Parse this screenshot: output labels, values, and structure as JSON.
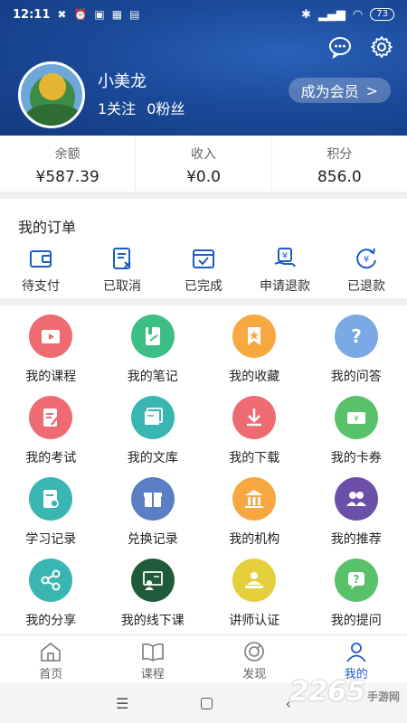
{
  "status_bar": {
    "time": "12:11",
    "battery": "73"
  },
  "profile": {
    "username": "小美龙",
    "following": "1关注",
    "followers": "0粉丝",
    "member_button": "成为会员",
    "member_chevron": ">"
  },
  "stats": [
    {
      "label": "余额",
      "value": "¥587.39"
    },
    {
      "label": "收入",
      "value": "¥0.0"
    },
    {
      "label": "积分",
      "value": "856.0"
    }
  ],
  "orders": {
    "title": "我的订单",
    "items": [
      {
        "label": "待支付",
        "icon": "wallet-icon"
      },
      {
        "label": "已取消",
        "icon": "cancel-doc-icon"
      },
      {
        "label": "已完成",
        "icon": "done-calendar-icon"
      },
      {
        "label": "申请退款",
        "icon": "refund-request-icon"
      },
      {
        "label": "已退款",
        "icon": "refunded-icon"
      }
    ]
  },
  "grid": [
    {
      "label": "我的课程",
      "icon": "course-icon",
      "color": "#ef6b72"
    },
    {
      "label": "我的笔记",
      "icon": "notes-icon",
      "color": "#3bbf84"
    },
    {
      "label": "我的收藏",
      "icon": "favorite-icon",
      "color": "#f7a840"
    },
    {
      "label": "我的问答",
      "icon": "qa-icon",
      "color": "#7aa9e6"
    },
    {
      "label": "我的考试",
      "icon": "exam-icon",
      "color": "#ef6b72"
    },
    {
      "label": "我的文库",
      "icon": "library-icon",
      "color": "#39b6b1"
    },
    {
      "label": "我的下载",
      "icon": "download-icon",
      "color": "#ef6b72"
    },
    {
      "label": "我的卡券",
      "icon": "coupon-icon",
      "color": "#59c16a"
    },
    {
      "label": "学习记录",
      "icon": "study-record-icon",
      "color": "#39b6b1"
    },
    {
      "label": "兑换记录",
      "icon": "exchange-record-icon",
      "color": "#5b7fc4"
    },
    {
      "label": "我的机构",
      "icon": "institution-icon",
      "color": "#f7a840"
    },
    {
      "label": "我的推荐",
      "icon": "recommend-icon",
      "color": "#6b4fa8"
    },
    {
      "label": "我的分享",
      "icon": "share-icon",
      "color": "#39b6b1"
    },
    {
      "label": "我的线下课",
      "icon": "offline-course-icon",
      "color": "#1f5a3a"
    },
    {
      "label": "讲师认证",
      "icon": "lecturer-cert-icon",
      "color": "#e5cf3a"
    },
    {
      "label": "我的提问",
      "icon": "question-icon",
      "color": "#59c16a"
    }
  ],
  "bottom_nav": [
    {
      "label": "首页",
      "icon": "home-icon"
    },
    {
      "label": "课程",
      "icon": "book-icon"
    },
    {
      "label": "发现",
      "icon": "discover-icon"
    },
    {
      "label": "我的",
      "icon": "profile-icon",
      "active": true
    }
  ],
  "colors": {
    "header": "#1b4a9a",
    "accent": "#1d5cc6"
  },
  "watermark": {
    "brand": "2265",
    "site": "手游网"
  }
}
